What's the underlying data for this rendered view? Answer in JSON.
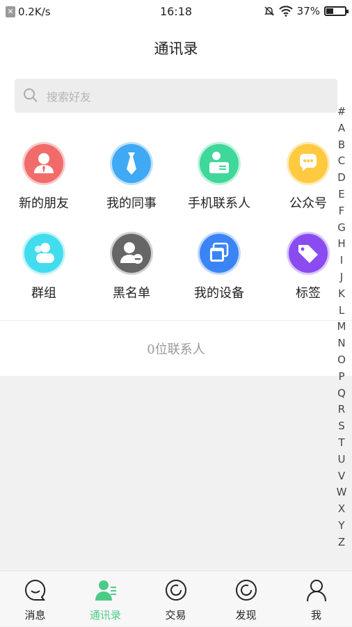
{
  "status_bar": {
    "net_speed": "0.2K/s",
    "time": "16:18",
    "battery": "37%",
    "battery_level": 0.37
  },
  "header": {
    "title": "通讯录"
  },
  "search": {
    "placeholder": "搜索好友"
  },
  "grid": [
    {
      "label": "新的朋友",
      "icon": "person-tie-icon",
      "color": "#f26b6b"
    },
    {
      "label": "我的同事",
      "icon": "necktie-icon",
      "color": "#3fa9f5"
    },
    {
      "label": "手机联系人",
      "icon": "contact-card-icon",
      "color": "#3fd79a"
    },
    {
      "label": "公众号",
      "icon": "chat-bubble-icon",
      "color": "#ffc940"
    },
    {
      "label": "群组",
      "icon": "group-icon",
      "color": "#42dcef"
    },
    {
      "label": "黑名单",
      "icon": "blocked-user-icon",
      "color": "#666666"
    },
    {
      "label": "我的设备",
      "icon": "devices-icon",
      "color": "#3a84f5"
    },
    {
      "label": "标签",
      "icon": "tag-icon",
      "color": "#8a4cf0"
    }
  ],
  "contact_count": "0位联系人",
  "alphabet": [
    "#",
    "A",
    "B",
    "C",
    "D",
    "E",
    "F",
    "G",
    "H",
    "I",
    "J",
    "K",
    "L",
    "M",
    "N",
    "O",
    "P",
    "Q",
    "R",
    "S",
    "T",
    "U",
    "V",
    "W",
    "X",
    "Y",
    "Z"
  ],
  "tabs": [
    {
      "label": "消息",
      "icon": "chat-icon"
    },
    {
      "label": "通讯录",
      "icon": "contacts-icon",
      "active": true
    },
    {
      "label": "交易",
      "icon": "trade-icon"
    },
    {
      "label": "发现",
      "icon": "discover-icon"
    },
    {
      "label": "我",
      "icon": "profile-icon"
    }
  ],
  "colors": {
    "accent": "#4ccb88"
  }
}
